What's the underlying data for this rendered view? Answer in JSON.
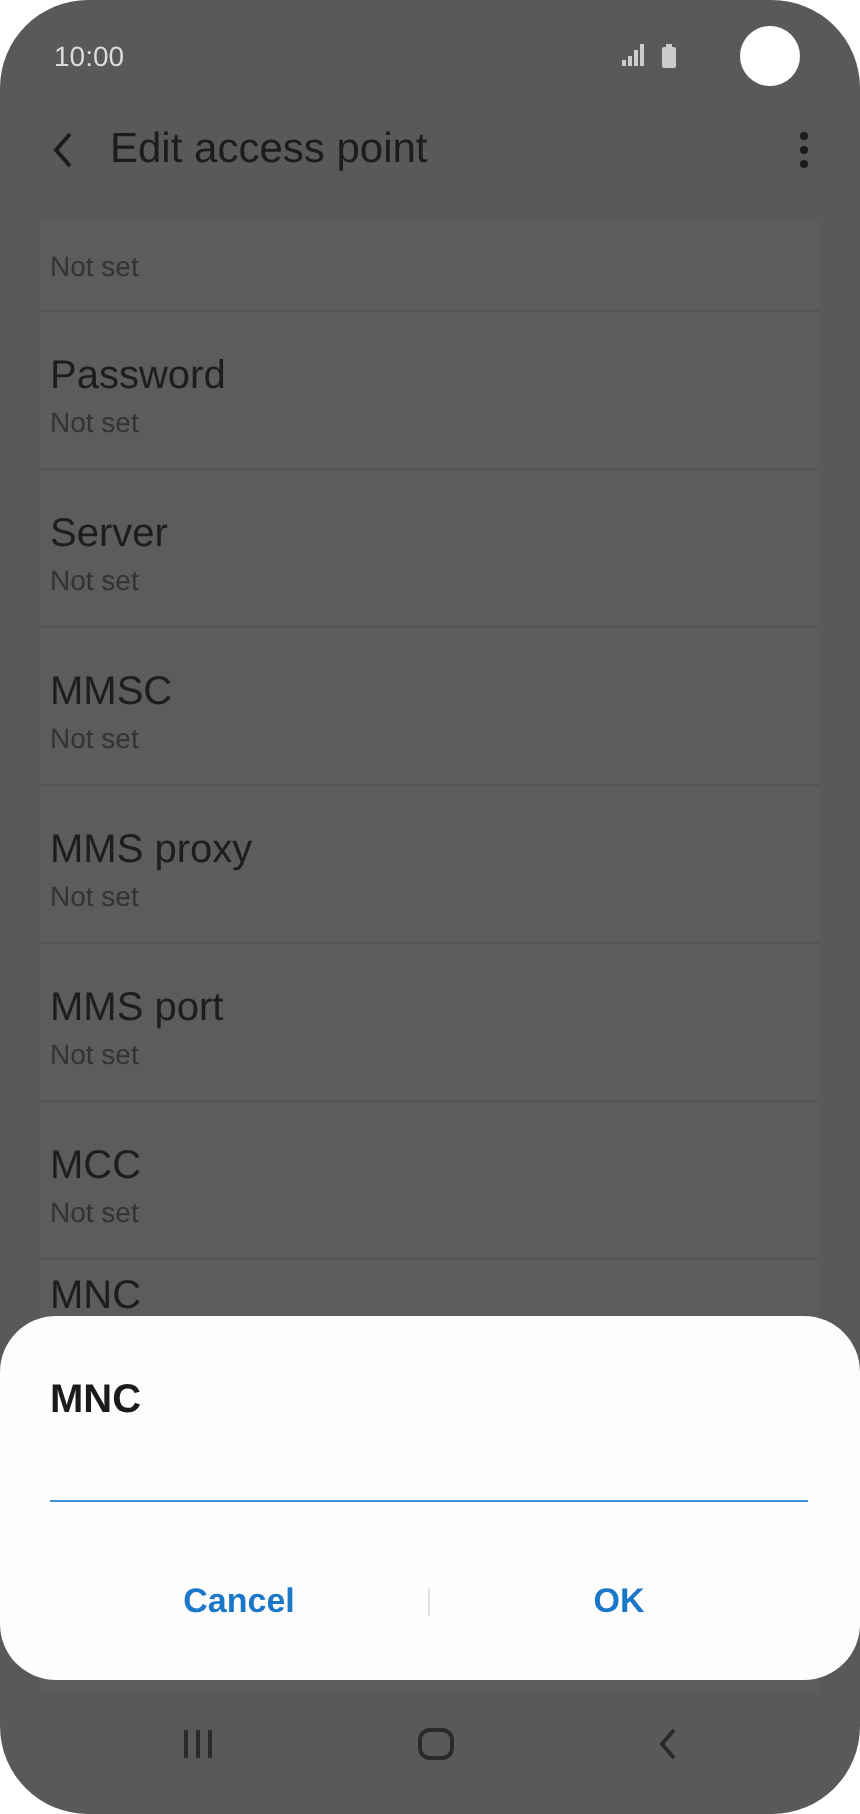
{
  "status_bar": {
    "time": "10:00"
  },
  "header": {
    "title": "Edit access point"
  },
  "settings": [
    {
      "value": "Not set"
    },
    {
      "label": "Password",
      "value": "Not set"
    },
    {
      "label": "Server",
      "value": "Not set"
    },
    {
      "label": "MMSC",
      "value": "Not set"
    },
    {
      "label": "MMS proxy",
      "value": "Not set"
    },
    {
      "label": "MMS port",
      "value": "Not set"
    },
    {
      "label": "MCC",
      "value": "Not set"
    },
    {
      "label": "MNC"
    }
  ],
  "dialog": {
    "title": "MNC",
    "buttons": [
      "Cancel",
      "OK"
    ]
  }
}
